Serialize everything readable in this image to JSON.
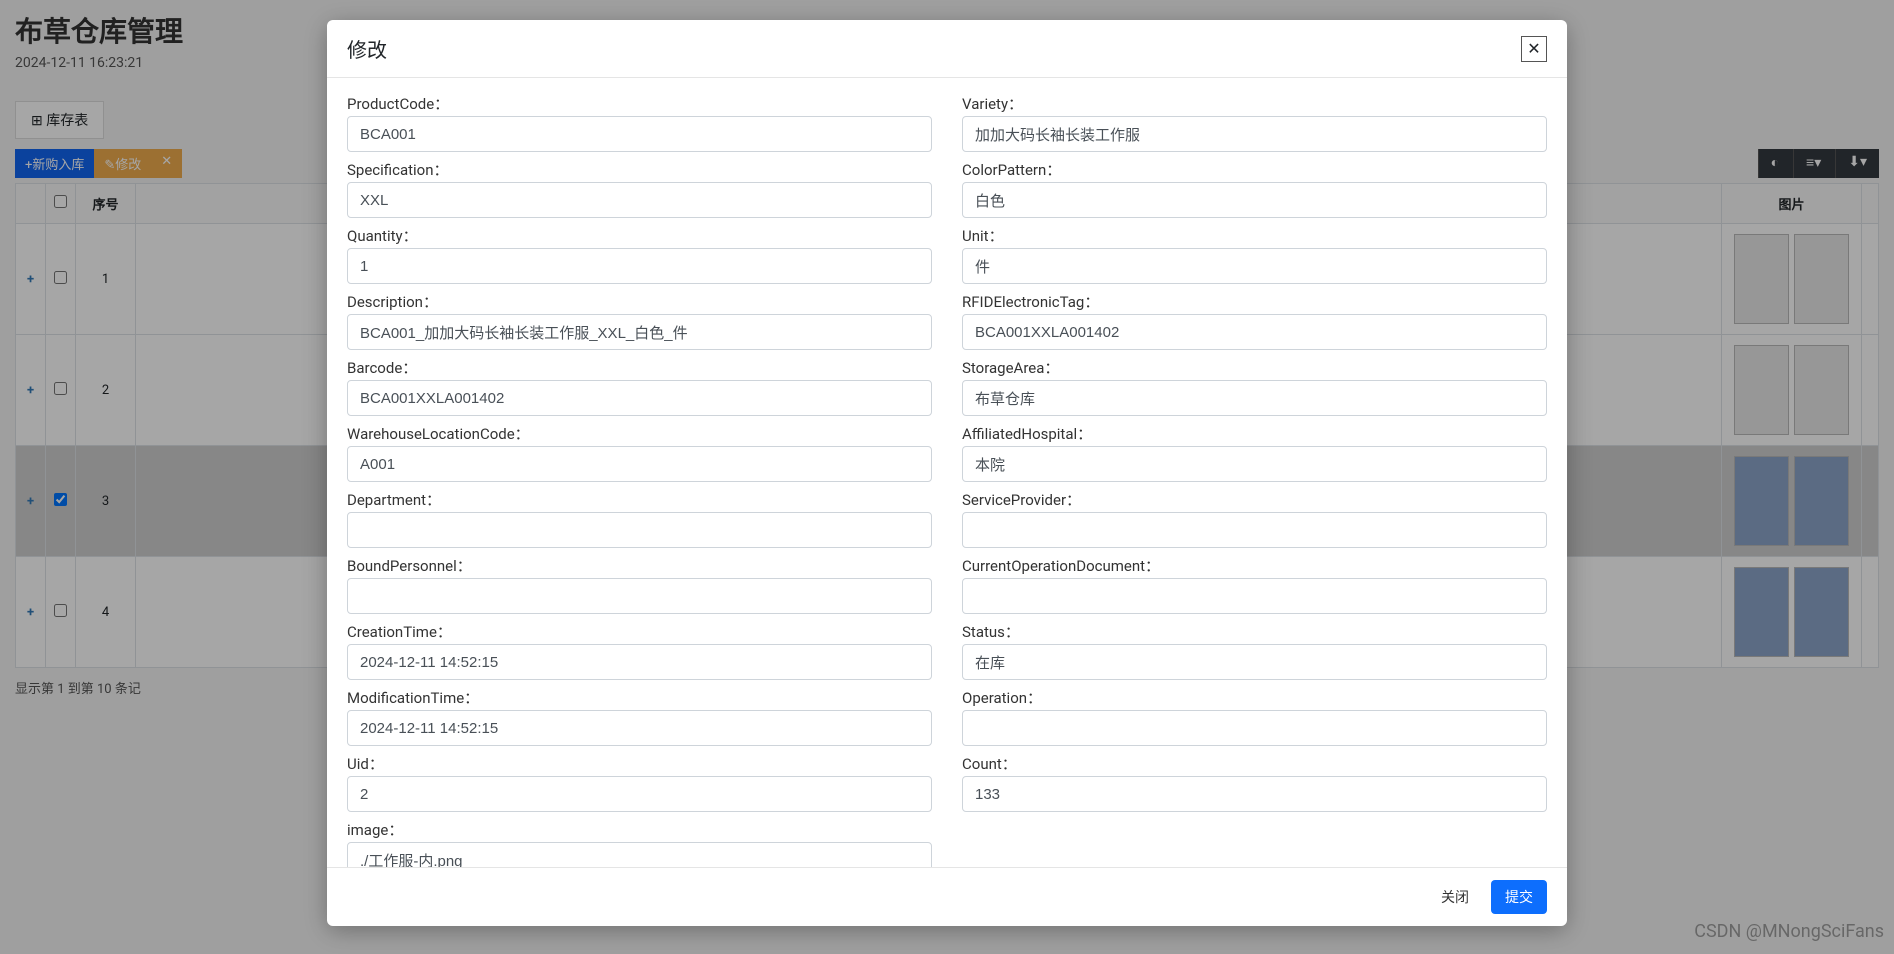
{
  "page": {
    "title": "布草仓库管理",
    "timestamp": "2024-12-11 16:23:21",
    "tab_label": "库存表",
    "toolbar": {
      "new_in": "+新购入库",
      "edit": "✎修改",
      "del": "✕"
    },
    "columns": {
      "seq": "序号",
      "image": "图片"
    },
    "rows": [
      {
        "seq": "1",
        "selected": false,
        "imgstyle": "coat"
      },
      {
        "seq": "2",
        "selected": false,
        "imgstyle": "coat"
      },
      {
        "seq": "3",
        "selected": true,
        "imgstyle": "shirt"
      },
      {
        "seq": "4",
        "selected": false,
        "imgstyle": "shirt"
      }
    ],
    "pager_text": "显示第 1 到第 10 条记",
    "watermark": "CSDN @MNongSciFans"
  },
  "modal": {
    "title": "修改",
    "buttons": {
      "close": "关闭",
      "submit": "提交"
    },
    "fields": {
      "ProductCode": {
        "label": "ProductCode：",
        "value": "BCA001"
      },
      "Variety": {
        "label": "Variety：",
        "value": "加加大码长袖长装工作服"
      },
      "Specification": {
        "label": "Specification：",
        "value": "XXL"
      },
      "ColorPattern": {
        "label": "ColorPattern：",
        "value": "白色"
      },
      "Quantity": {
        "label": "Quantity：",
        "value": "1"
      },
      "Unit": {
        "label": "Unit：",
        "value": "件"
      },
      "Description": {
        "label": "Description：",
        "value": "BCA001_加加大码长袖长装工作服_XXL_白色_件"
      },
      "RFIDElectronicTag": {
        "label": "RFIDElectronicTag：",
        "value": "BCA001XXLA001402"
      },
      "Barcode": {
        "label": "Barcode：",
        "value": "BCA001XXLA001402"
      },
      "StorageArea": {
        "label": "StorageArea：",
        "value": "布草仓库"
      },
      "WarehouseLocationCode": {
        "label": "WarehouseLocationCode：",
        "value": "A001"
      },
      "AffiliatedHospital": {
        "label": "AffiliatedHospital：",
        "value": "本院"
      },
      "Department": {
        "label": "Department：",
        "value": ""
      },
      "ServiceProvider": {
        "label": "ServiceProvider：",
        "value": ""
      },
      "BoundPersonnel": {
        "label": "BoundPersonnel：",
        "value": ""
      },
      "CurrentOperationDocument": {
        "label": "CurrentOperationDocument：",
        "value": ""
      },
      "CreationTime": {
        "label": "CreationTime：",
        "value": "2024-12-11 14:52:15"
      },
      "Status": {
        "label": "Status：",
        "value": "在库"
      },
      "ModificationTime": {
        "label": "ModificationTime：",
        "value": "2024-12-11 14:52:15"
      },
      "Operation": {
        "label": "Operation：",
        "value": ""
      },
      "Uid": {
        "label": "Uid：",
        "value": "2"
      },
      "Count": {
        "label": "Count：",
        "value": "133"
      },
      "image": {
        "label": "image：",
        "value": "./工作服-内.png"
      }
    },
    "left_order": [
      "ProductCode",
      "Specification",
      "Quantity",
      "Description",
      "Barcode",
      "WarehouseLocationCode",
      "Department",
      "BoundPersonnel",
      "CreationTime",
      "ModificationTime",
      "Uid",
      "image"
    ],
    "right_order": [
      "Variety",
      "ColorPattern",
      "Unit",
      "RFIDElectronicTag",
      "StorageArea",
      "AffiliatedHospital",
      "ServiceProvider",
      "CurrentOperationDocument",
      "Status",
      "Operation",
      "Count"
    ]
  }
}
